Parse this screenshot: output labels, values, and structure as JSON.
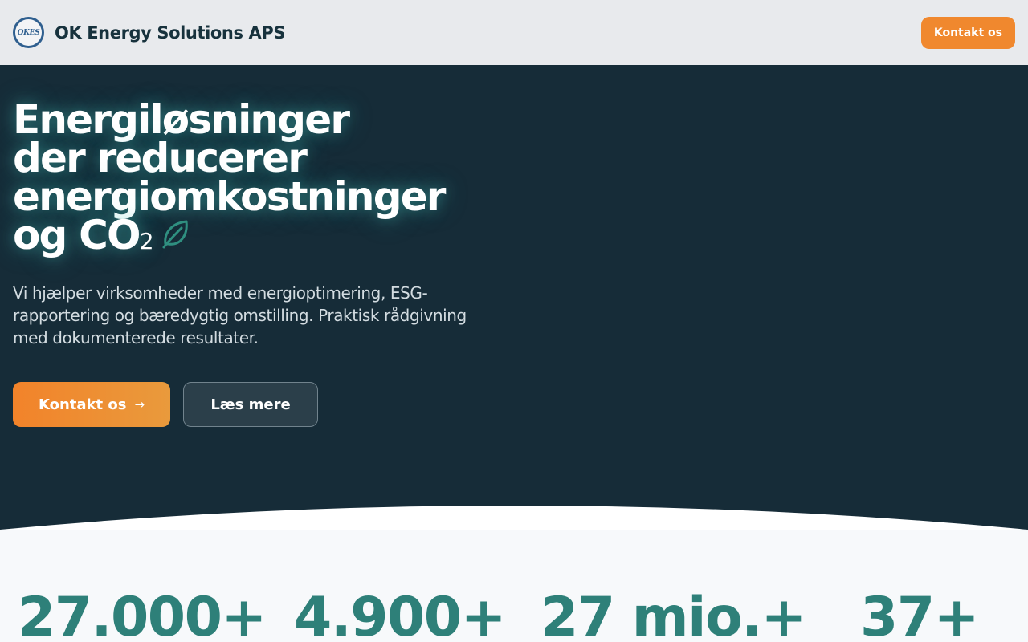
{
  "header": {
    "logo_text": "OKES",
    "brand_name": "OK Energy Solutions APS",
    "cta_label": "Kontakt os"
  },
  "hero": {
    "title_lines": [
      "Energiløsninger",
      "der reducerer",
      "energiomkostninger",
      "og CO"
    ],
    "title_subscript": "2",
    "description": "Vi hjælper virksomheder med energioptimering, ESG-rapportering og bæredygtig omstilling. Praktisk rådgivning med dokumenterede resultater.",
    "primary_button": "Kontakt os",
    "primary_button_icon": "→",
    "secondary_button": "Læs mere"
  },
  "stats": [
    {
      "value": "27.000+"
    },
    {
      "value": "4.900+"
    },
    {
      "value": "27 mio.+"
    },
    {
      "value": "37+"
    }
  ],
  "colors": {
    "header_bg": "#e8eaed",
    "hero_bg": "#162c38",
    "accent_orange": "#f0882e",
    "stat_teal": "#2e8079",
    "leaf_teal": "#2f8f80"
  }
}
